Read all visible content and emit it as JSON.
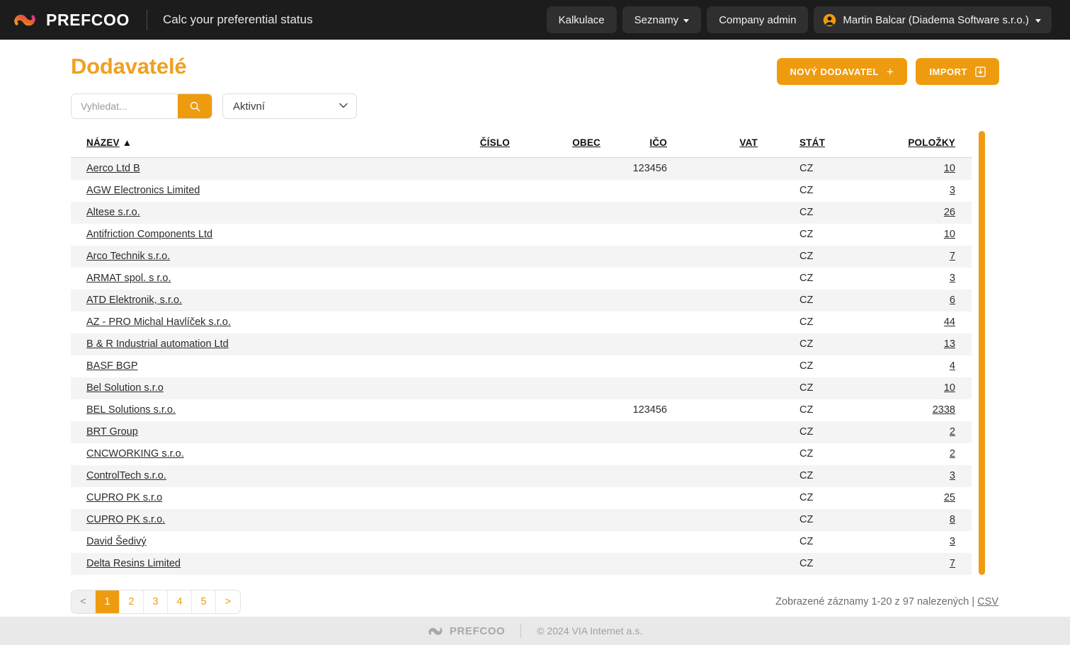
{
  "header": {
    "brand_name": "PREFCOO",
    "tagline": "Calc your preferential status",
    "nav": {
      "kalkulace": "Kalkulace",
      "seznamy": "Seznamy",
      "company_admin": "Company admin",
      "user": "Martin Balcar (Diadema Software s.r.o.)"
    }
  },
  "page": {
    "title": "Dodavatelé",
    "new_supplier_button": "NOVÝ DODAVATEL",
    "new_supplier_plus": "+",
    "import_button": "IMPORT"
  },
  "filters": {
    "search_placeholder": "Vyhledat...",
    "search_value": "",
    "status_selected": "Aktivní",
    "status_options": [
      "Aktivní"
    ]
  },
  "table": {
    "columns": [
      {
        "key": "nazev",
        "label": "NÁZEV",
        "sort_indicator": " ▲"
      },
      {
        "key": "cislo",
        "label": "ČÍSLO",
        "sort_indicator": ""
      },
      {
        "key": "obec",
        "label": "OBEC",
        "sort_indicator": ""
      },
      {
        "key": "ico",
        "label": "IČO",
        "sort_indicator": ""
      },
      {
        "key": "vat",
        "label": "VAT",
        "sort_indicator": ""
      },
      {
        "key": "stat",
        "label": "STÁT",
        "sort_indicator": ""
      },
      {
        "key": "polozky",
        "label": "POLOŽKY",
        "sort_indicator": ""
      }
    ],
    "rows": [
      {
        "nazev": "Aerco Ltd B",
        "cislo": "",
        "obec": "",
        "ico": "123456",
        "vat": "",
        "stat": "CZ",
        "polozky": "10"
      },
      {
        "nazev": "AGW Electronics Limited",
        "cislo": "",
        "obec": "",
        "ico": "",
        "vat": "",
        "stat": "CZ",
        "polozky": "3"
      },
      {
        "nazev": "Altese s.r.o.",
        "cislo": "",
        "obec": "",
        "ico": "",
        "vat": "",
        "stat": "CZ",
        "polozky": "26"
      },
      {
        "nazev": "Antifriction Components Ltd",
        "cislo": "",
        "obec": "",
        "ico": "",
        "vat": "",
        "stat": "CZ",
        "polozky": "10"
      },
      {
        "nazev": "Arco Technik s.r.o.",
        "cislo": "",
        "obec": "",
        "ico": "",
        "vat": "",
        "stat": "CZ",
        "polozky": "7"
      },
      {
        "nazev": "ARMAT spol. s r.o.",
        "cislo": "",
        "obec": "",
        "ico": "",
        "vat": "",
        "stat": "CZ",
        "polozky": "3"
      },
      {
        "nazev": "ATD Elektronik, s.r.o.",
        "cislo": "",
        "obec": "",
        "ico": "",
        "vat": "",
        "stat": "CZ",
        "polozky": "6"
      },
      {
        "nazev": "AZ - PRO Michal Havlíček s.r.o.",
        "cislo": "",
        "obec": "",
        "ico": "",
        "vat": "",
        "stat": "CZ",
        "polozky": "44"
      },
      {
        "nazev": "B & R Industrial automation Ltd",
        "cislo": "",
        "obec": "",
        "ico": "",
        "vat": "",
        "stat": "CZ",
        "polozky": "13"
      },
      {
        "nazev": "BASF BGP",
        "cislo": "",
        "obec": "",
        "ico": "",
        "vat": "",
        "stat": "CZ",
        "polozky": "4"
      },
      {
        "nazev": "Bel Solution s.r.o",
        "cislo": "",
        "obec": "",
        "ico": "",
        "vat": "",
        "stat": "CZ",
        "polozky": "10"
      },
      {
        "nazev": "BEL Solutions s.r.o.",
        "cislo": "",
        "obec": "",
        "ico": "123456",
        "vat": "",
        "stat": "CZ",
        "polozky": "2338"
      },
      {
        "nazev": "BRT Group",
        "cislo": "",
        "obec": "",
        "ico": "",
        "vat": "",
        "stat": "CZ",
        "polozky": "2"
      },
      {
        "nazev": "CNCWORKING s.r.o.",
        "cislo": "",
        "obec": "",
        "ico": "",
        "vat": "",
        "stat": "CZ",
        "polozky": "2"
      },
      {
        "nazev": "ControlTech s.r.o.",
        "cislo": "",
        "obec": "",
        "ico": "",
        "vat": "",
        "stat": "CZ",
        "polozky": "3"
      },
      {
        "nazev": "CUPRO PK s.r.o",
        "cislo": "",
        "obec": "",
        "ico": "",
        "vat": "",
        "stat": "CZ",
        "polozky": "25"
      },
      {
        "nazev": "CUPRO PK s.r.o.",
        "cislo": "",
        "obec": "",
        "ico": "",
        "vat": "",
        "stat": "CZ",
        "polozky": "8"
      },
      {
        "nazev": "David Šedivý",
        "cislo": "",
        "obec": "",
        "ico": "",
        "vat": "",
        "stat": "CZ",
        "polozky": "3"
      },
      {
        "nazev": "Delta Resins Limited",
        "cislo": "",
        "obec": "",
        "ico": "",
        "vat": "",
        "stat": "CZ",
        "polozky": "7"
      }
    ]
  },
  "pagination": {
    "prev": "<",
    "pages": [
      "1",
      "2",
      "3",
      "4",
      "5"
    ],
    "next": ">",
    "active_page": "1",
    "records_text": "Zobrazené záznamy 1-20 z 97 nalezených | ",
    "csv_label": "CSV"
  },
  "footer": {
    "brand_name": "PREFCOO",
    "copyright": "© 2024 VIA Internet a.s."
  },
  "colors": {
    "accent_orange": "#ef9b10",
    "title_orange": "#f0a020",
    "header_dark": "#1c1c1c",
    "row_stripe": "#f4f4f4",
    "footer_bg": "#e9e9e9"
  }
}
